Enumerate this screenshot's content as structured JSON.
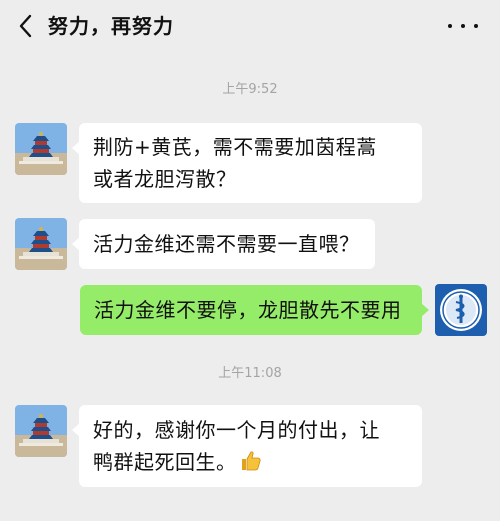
{
  "header": {
    "title": "努力，再努力",
    "back_icon": "chevron-left-icon",
    "more_icon": "more-dots-icon"
  },
  "messages": {
    "time1": "上午9:52",
    "msg1_line1": "荆防+黄芪，需不需要加茵程蒿",
    "msg1_line2": "或者龙胆泻散？",
    "msg2": "活力金维还需不需要一直喂？",
    "msg3": "活力金维不要停，龙胆散先不要用",
    "time2": "上午11:08",
    "msg4_line1": "好的，感谢你一个月的付出，让",
    "msg4_line2": "鸭群起死回生。",
    "msg4_emoji": "thumbs-up-icon"
  },
  "avatars": {
    "left": "temple-of-heaven-avatar",
    "right": "medical-emblem-avatar"
  },
  "colors": {
    "background": "#ededed",
    "bubble_left": "#ffffff",
    "bubble_right": "#95ec69",
    "timestamp": "#a4a4a4",
    "emblem_blue": "#1d5fae"
  }
}
